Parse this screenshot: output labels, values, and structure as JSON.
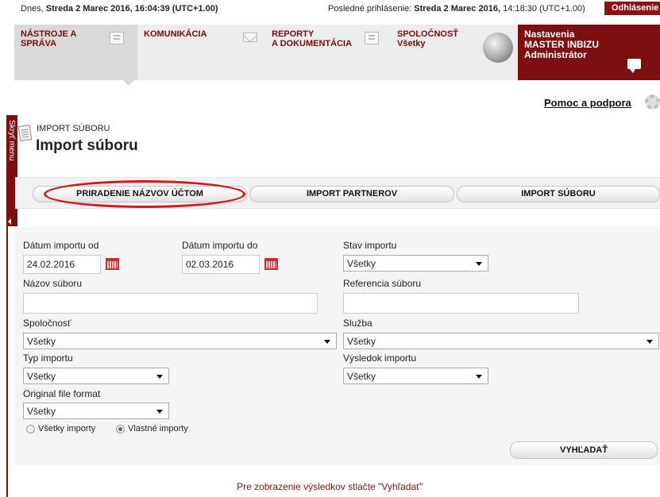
{
  "topbar": {
    "today_prefix": "Dnes, ",
    "today_value": "Streda 2 Marec 2016, 16:04:39 (UTC+1.00)",
    "last_login_prefix": "Posledné prihlásenie: ",
    "last_login_date": "Streda 2 Marec 2016,",
    "last_login_time": " 14:18:30 (UTC+1.00)",
    "logout_label": "Odhlásenie"
  },
  "nav": {
    "items": [
      {
        "line1": "NÁSTROJE A",
        "line2": "SPRÁVA",
        "icon": "document-icon"
      },
      {
        "line1": "KOMUNIKÁCIA",
        "line2": "",
        "icon": "mail-icon"
      },
      {
        "line1": "REPORTY",
        "line2": "A DOKUMENTÁCIA",
        "icon": "document-icon"
      },
      {
        "line1": "SPOLOČNOSŤ",
        "line2": "Všetky",
        "icon": "globe-icon"
      }
    ],
    "settings": {
      "line1": "Nastavenia",
      "line2": "MASTER INBIZU",
      "line3": "Administrátor",
      "icon": "chat-icon"
    }
  },
  "side_menu_label": "Skryť menu",
  "help_label": "Pomoc a podpora",
  "page": {
    "breadcrumb": "IMPORT SÚBORU",
    "title": "Import súboru"
  },
  "tabs": [
    {
      "label": "PRIRADENIE NÁZVOV ÚČTOM"
    },
    {
      "label": "IMPORT PARTNEROV"
    },
    {
      "label": "IMPORT SÚBORU"
    }
  ],
  "filters": {
    "date_from_label": "Dátum importu od",
    "date_from_value": "24.02.2016",
    "date_to_label": "Dátum importu do",
    "date_to_value": "02.03.2016",
    "status_label": "Stav importu",
    "status_value": "Všetky",
    "file_name_label": "Názov súboru",
    "file_name_value": "",
    "file_ref_label": "Referencia súboru",
    "file_ref_value": "",
    "company_label": "Spoločnosť",
    "company_value": "Všetky",
    "service_label": "Služba",
    "service_value": "Všetky",
    "type_label": "Typ importu",
    "type_value": "Všetky",
    "result_label": "Výsledok importu",
    "result_value": "Všetky",
    "format_label": "Original file format",
    "format_value": "Všetky",
    "radio_all_label": "Všetky importy",
    "radio_own_label": "Vlastné importy",
    "selected_radio": "own"
  },
  "search_button_label": "VYHĽADAŤ",
  "results_hint": "Pre zobrazenie výsledkov stlačte \"Vyhľadať\"",
  "colors": {
    "brand": "#7d0f11",
    "highlight": "#d8141a"
  }
}
